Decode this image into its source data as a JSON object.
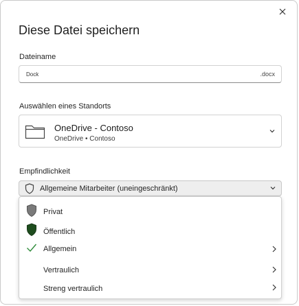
{
  "dialog": {
    "title": "Diese Datei speichern",
    "close_icon": "close-icon"
  },
  "filename": {
    "label": "Dateiname",
    "value": "Dock",
    "extension": ".docx"
  },
  "location": {
    "label": "Auswählen eines Standorts",
    "name": "OneDrive - Contoso",
    "path": "OneDrive • Contoso",
    "icon": "folder-icon"
  },
  "sensitivity": {
    "label": "Empfindlichkeit",
    "selected": "Allgemeine Mitarbeiter (uneingeschränkt)",
    "options": [
      {
        "label": "Privat",
        "icon": "shield-gray-icon",
        "submenu": false
      },
      {
        "label": "Öffentlich",
        "icon": "shield-green-icon",
        "submenu": false
      },
      {
        "label": "Allgemein",
        "icon": "checkmark-icon",
        "submenu": true,
        "checked": true
      },
      {
        "label": "Vertraulich",
        "icon": "",
        "submenu": true
      },
      {
        "label": "Streng vertraulich",
        "icon": "",
        "submenu": true
      }
    ]
  },
  "colors": {
    "shield_gray": "#7a7a7a",
    "shield_green": "#1e4d1e",
    "check_green": "#2e8b3a",
    "border": "#d1d1d1"
  }
}
